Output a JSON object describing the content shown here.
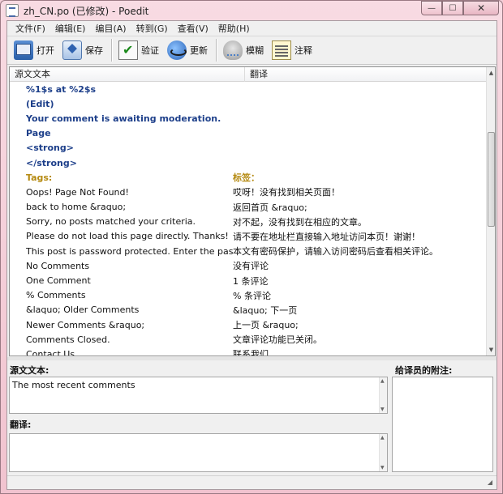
{
  "window": {
    "title": "zh_CN.po (已修改) - Poedit",
    "minimize": "—",
    "maximize": "☐",
    "close": "✕"
  },
  "menu": [
    "文件(F)",
    "编辑(E)",
    "编目(A)",
    "转到(G)",
    "查看(V)",
    "帮助(H)"
  ],
  "toolbar": {
    "open": "打开",
    "save": "保存",
    "validate": "验证",
    "update": "更新",
    "fuzzy": "模糊",
    "comment": "注释"
  },
  "list": {
    "header_source": "源文文本",
    "header_translation": "翻译",
    "rows": [
      {
        "source": "%1$s at %2$s",
        "translation": "",
        "state": "untranslated"
      },
      {
        "source": "(Edit)",
        "translation": "",
        "state": "untranslated"
      },
      {
        "source": "Your comment is awaiting moderation.",
        "translation": "",
        "state": "untranslated"
      },
      {
        "source": "Page",
        "translation": "",
        "state": "untranslated"
      },
      {
        "source": "<strong>",
        "translation": "",
        "state": "untranslated"
      },
      {
        "source": "</strong>",
        "translation": "",
        "state": "untranslated"
      },
      {
        "source": "Tags:",
        "translation": "标签：",
        "state": "fuzzy"
      },
      {
        "source": "Oops! Page Not Found!",
        "translation": "哎呀！没有找到相关页面！",
        "state": "normal"
      },
      {
        "source": "back to home &raquo;",
        "translation": "返回首页 &raquo;",
        "state": "normal"
      },
      {
        "source": "Sorry, no posts matched your criteria.",
        "translation": "对不起，没有找到在相应的文章。",
        "state": "normal"
      },
      {
        "source": "Please do not load this page directly. Thanks!",
        "translation": "请不要在地址栏直接输入地址访问本页！谢谢！",
        "state": "normal"
      },
      {
        "source": "This post is password protected. Enter the passwor...",
        "translation": "本文有密码保护，请输入访问密码后查看相关评论。",
        "state": "normal"
      },
      {
        "source": "No Comments",
        "translation": "没有评论",
        "state": "normal"
      },
      {
        "source": "One Comment",
        "translation": "1 条评论",
        "state": "normal"
      },
      {
        "source": "% Comments",
        "translation": "% 条评论",
        "state": "normal"
      },
      {
        "source": "&laquo; Older Comments",
        "translation": "&laquo; 下一页",
        "state": "normal"
      },
      {
        "source": "Newer Comments  &raquo;",
        "translation": "上一页  &raquo;",
        "state": "normal"
      },
      {
        "source": "Comments Closed.",
        "translation": "文章评论功能已关闭。",
        "state": "normal"
      },
      {
        "source": "Contact Us",
        "translation": "联系我们",
        "state": "normal"
      }
    ]
  },
  "editor": {
    "source_label": "源文文本:",
    "source_text": "The most recent comments",
    "translation_label": "翻译:",
    "translation_text": "",
    "notes_label": "给译员的附注:",
    "notes_text": ""
  },
  "status": {
    "text": ""
  }
}
